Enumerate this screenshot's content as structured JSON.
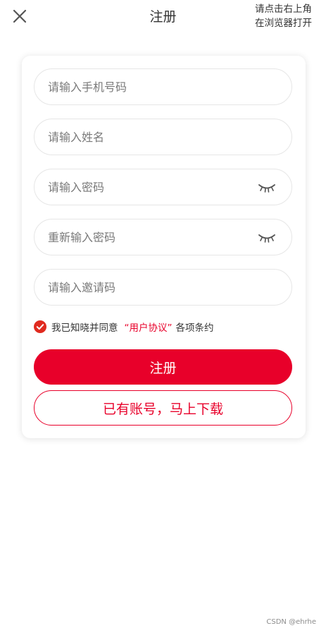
{
  "header": {
    "title": "注册",
    "hint_line1": "请点击右上角",
    "hint_line2": "在浏览器打开"
  },
  "form": {
    "phone_placeholder": "请输入手机号码",
    "name_placeholder": "请输入姓名",
    "password_placeholder": "请输入密码",
    "confirm_placeholder": "重新输入密码",
    "invite_placeholder": "请输入邀请码"
  },
  "agreement": {
    "checked": true,
    "prefix": "我已知晓并同意",
    "link": "“用户协议”",
    "suffix": "各项条约"
  },
  "actions": {
    "register_label": "注册",
    "download_label": "已有账号，马上下载"
  },
  "watermark": "CSDN @ehrhe",
  "colors": {
    "accent": "#e8002a",
    "text": "#333333",
    "placeholder": "#7a7a7a",
    "border": "#e6e6e6"
  }
}
